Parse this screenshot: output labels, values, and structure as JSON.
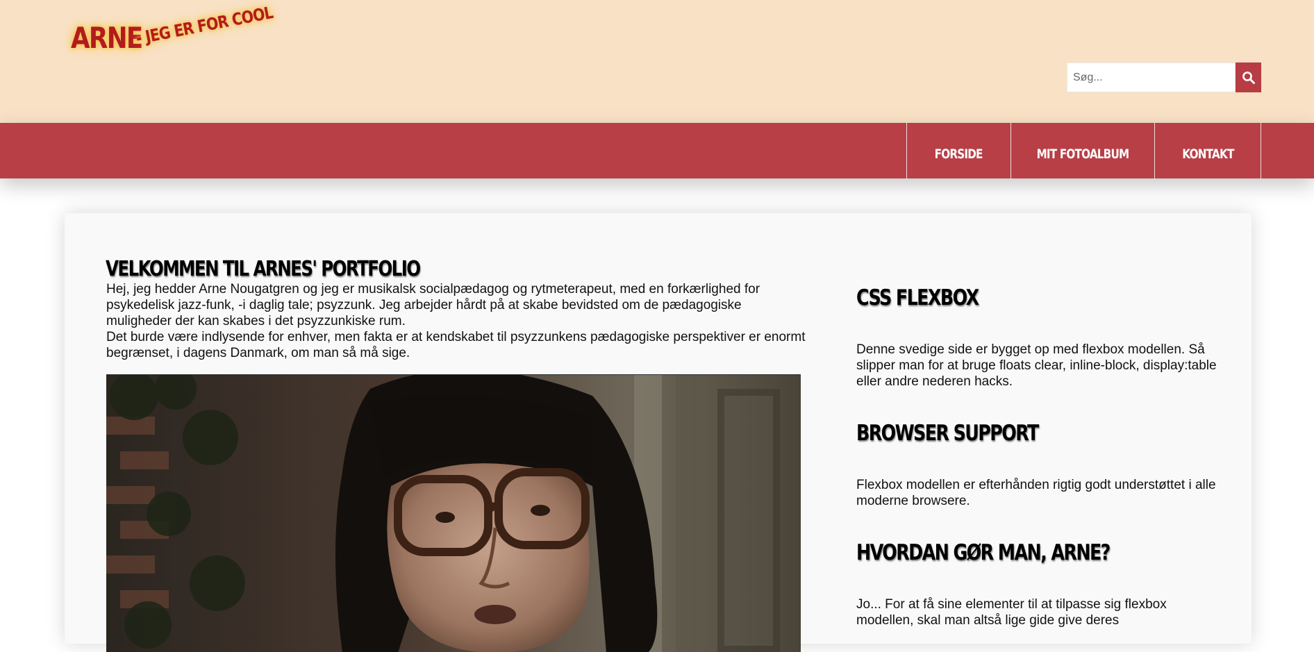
{
  "logo": {
    "name": "ARNE",
    "tagline": "- JEG ER FOR COOL"
  },
  "search": {
    "placeholder": "Søg...",
    "button_icon": "search-icon"
  },
  "nav": {
    "items": [
      {
        "label": "FORSIDE"
      },
      {
        "label": "MIT FOTOALBUM"
      },
      {
        "label": "KONTAKT"
      }
    ]
  },
  "main": {
    "title": "VELKOMMEN TIL ARNES' PORTFOLIO",
    "paragraphs": [
      "Hej, jeg hedder Arne Nougatgren og jeg er musikalsk socialpædagog og rytmeterapeut, med en forkærlighed for psykedelisk jazz-funk, -i daglig tale; psyzzunk. Jeg arbejder hårdt på at skabe bevidsted om de pædagogiske muligheder der kan skabes i det psyzzunkiske rum.",
      "Det burde være indlysende for enhver, men fakta er at kendskabet til psyzzunkens pædagogiske perspektiver er enormt begrænset, i dagens Danmark, om man så må sige."
    ]
  },
  "sidebar": {
    "sections": [
      {
        "title": "CSS FLEXBOX",
        "text": "Denne svedige side er bygget op med flexbox modellen. Så slipper man for at bruge floats clear, inline-block, display:table eller andre nederen hacks."
      },
      {
        "title": "BROWSER SUPPORT",
        "text": "Flexbox modellen er efterhånden rigtig godt understøttet i alle moderne browsere."
      },
      {
        "title": "HVORDAN GØR MAN, ARNE?",
        "text": "Jo... For at få sine elementer til at tilpasse sig flexbox modellen, skal man altså lige gide give deres"
      }
    ]
  },
  "colors": {
    "header_bg": "#f8e1c5",
    "nav_bg": "#b83f46",
    "accent": "#b73c43",
    "card_bg": "#f8f9f8"
  }
}
